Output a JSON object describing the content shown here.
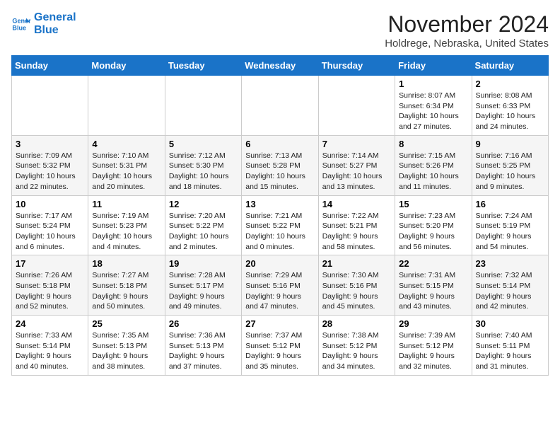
{
  "logo": {
    "line1": "General",
    "line2": "Blue"
  },
  "title": "November 2024",
  "subtitle": "Holdrege, Nebraska, United States",
  "days_of_week": [
    "Sunday",
    "Monday",
    "Tuesday",
    "Wednesday",
    "Thursday",
    "Friday",
    "Saturday"
  ],
  "weeks": [
    [
      {
        "day": "",
        "detail": ""
      },
      {
        "day": "",
        "detail": ""
      },
      {
        "day": "",
        "detail": ""
      },
      {
        "day": "",
        "detail": ""
      },
      {
        "day": "",
        "detail": ""
      },
      {
        "day": "1",
        "detail": "Sunrise: 8:07 AM\nSunset: 6:34 PM\nDaylight: 10 hours\nand 27 minutes."
      },
      {
        "day": "2",
        "detail": "Sunrise: 8:08 AM\nSunset: 6:33 PM\nDaylight: 10 hours\nand 24 minutes."
      }
    ],
    [
      {
        "day": "3",
        "detail": "Sunrise: 7:09 AM\nSunset: 5:32 PM\nDaylight: 10 hours\nand 22 minutes."
      },
      {
        "day": "4",
        "detail": "Sunrise: 7:10 AM\nSunset: 5:31 PM\nDaylight: 10 hours\nand 20 minutes."
      },
      {
        "day": "5",
        "detail": "Sunrise: 7:12 AM\nSunset: 5:30 PM\nDaylight: 10 hours\nand 18 minutes."
      },
      {
        "day": "6",
        "detail": "Sunrise: 7:13 AM\nSunset: 5:28 PM\nDaylight: 10 hours\nand 15 minutes."
      },
      {
        "day": "7",
        "detail": "Sunrise: 7:14 AM\nSunset: 5:27 PM\nDaylight: 10 hours\nand 13 minutes."
      },
      {
        "day": "8",
        "detail": "Sunrise: 7:15 AM\nSunset: 5:26 PM\nDaylight: 10 hours\nand 11 minutes."
      },
      {
        "day": "9",
        "detail": "Sunrise: 7:16 AM\nSunset: 5:25 PM\nDaylight: 10 hours\nand 9 minutes."
      }
    ],
    [
      {
        "day": "10",
        "detail": "Sunrise: 7:17 AM\nSunset: 5:24 PM\nDaylight: 10 hours\nand 6 minutes."
      },
      {
        "day": "11",
        "detail": "Sunrise: 7:19 AM\nSunset: 5:23 PM\nDaylight: 10 hours\nand 4 minutes."
      },
      {
        "day": "12",
        "detail": "Sunrise: 7:20 AM\nSunset: 5:22 PM\nDaylight: 10 hours\nand 2 minutes."
      },
      {
        "day": "13",
        "detail": "Sunrise: 7:21 AM\nSunset: 5:22 PM\nDaylight: 10 hours\nand 0 minutes."
      },
      {
        "day": "14",
        "detail": "Sunrise: 7:22 AM\nSunset: 5:21 PM\nDaylight: 9 hours\nand 58 minutes."
      },
      {
        "day": "15",
        "detail": "Sunrise: 7:23 AM\nSunset: 5:20 PM\nDaylight: 9 hours\nand 56 minutes."
      },
      {
        "day": "16",
        "detail": "Sunrise: 7:24 AM\nSunset: 5:19 PM\nDaylight: 9 hours\nand 54 minutes."
      }
    ],
    [
      {
        "day": "17",
        "detail": "Sunrise: 7:26 AM\nSunset: 5:18 PM\nDaylight: 9 hours\nand 52 minutes."
      },
      {
        "day": "18",
        "detail": "Sunrise: 7:27 AM\nSunset: 5:18 PM\nDaylight: 9 hours\nand 50 minutes."
      },
      {
        "day": "19",
        "detail": "Sunrise: 7:28 AM\nSunset: 5:17 PM\nDaylight: 9 hours\nand 49 minutes."
      },
      {
        "day": "20",
        "detail": "Sunrise: 7:29 AM\nSunset: 5:16 PM\nDaylight: 9 hours\nand 47 minutes."
      },
      {
        "day": "21",
        "detail": "Sunrise: 7:30 AM\nSunset: 5:16 PM\nDaylight: 9 hours\nand 45 minutes."
      },
      {
        "day": "22",
        "detail": "Sunrise: 7:31 AM\nSunset: 5:15 PM\nDaylight: 9 hours\nand 43 minutes."
      },
      {
        "day": "23",
        "detail": "Sunrise: 7:32 AM\nSunset: 5:14 PM\nDaylight: 9 hours\nand 42 minutes."
      }
    ],
    [
      {
        "day": "24",
        "detail": "Sunrise: 7:33 AM\nSunset: 5:14 PM\nDaylight: 9 hours\nand 40 minutes."
      },
      {
        "day": "25",
        "detail": "Sunrise: 7:35 AM\nSunset: 5:13 PM\nDaylight: 9 hours\nand 38 minutes."
      },
      {
        "day": "26",
        "detail": "Sunrise: 7:36 AM\nSunset: 5:13 PM\nDaylight: 9 hours\nand 37 minutes."
      },
      {
        "day": "27",
        "detail": "Sunrise: 7:37 AM\nSunset: 5:12 PM\nDaylight: 9 hours\nand 35 minutes."
      },
      {
        "day": "28",
        "detail": "Sunrise: 7:38 AM\nSunset: 5:12 PM\nDaylight: 9 hours\nand 34 minutes."
      },
      {
        "day": "29",
        "detail": "Sunrise: 7:39 AM\nSunset: 5:12 PM\nDaylight: 9 hours\nand 32 minutes."
      },
      {
        "day": "30",
        "detail": "Sunrise: 7:40 AM\nSunset: 5:11 PM\nDaylight: 9 hours\nand 31 minutes."
      }
    ]
  ]
}
